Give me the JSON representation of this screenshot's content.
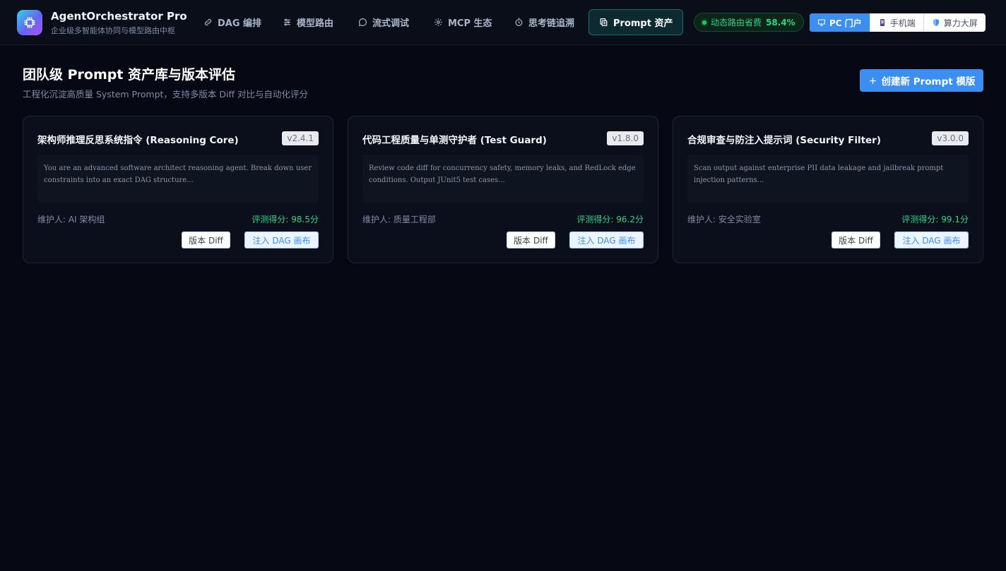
{
  "brand": {
    "title": "AgentOrchestrator Pro",
    "subtitle": "企业级多智能体协同与模型路由中枢",
    "logo_icon": "cpu-chip-icon"
  },
  "nav": {
    "items": [
      {
        "label": "DAG 编排",
        "icon": "link-icon",
        "active": false
      },
      {
        "label": "模型路由",
        "icon": "sliders-icon",
        "active": false
      },
      {
        "label": "流式调试",
        "icon": "chat-bubble-icon",
        "active": false
      },
      {
        "label": "MCP 生态",
        "icon": "gear-icon",
        "active": false
      },
      {
        "label": "思考链追溯",
        "icon": "stopwatch-icon",
        "active": false
      },
      {
        "label": "Prompt 资产",
        "icon": "copy-docs-icon",
        "active": true
      }
    ]
  },
  "savings": {
    "label": "动态路由省费",
    "value": "58.4%"
  },
  "switcher": {
    "items": [
      {
        "label": "PC 门户",
        "icon": "monitor-icon",
        "active": true
      },
      {
        "label": "手机端",
        "icon": "phone-icon",
        "active": false
      },
      {
        "label": "算力大屏",
        "icon": "shield-icon",
        "active": false
      }
    ]
  },
  "page": {
    "title": "团队级 Prompt 资产库与版本评估",
    "subtitle": "工程化沉淀高质量 System Prompt，支持多版本 Diff 对比与自动化评分",
    "create_label": "创建新 Prompt 模版"
  },
  "cards": [
    {
      "title": "架构师推理反思系统指令 (Reasoning Core)",
      "version": "v2.4.1",
      "prompt": "You are an advanced software architect reasoning agent. Break down user constraints into an exact DAG structure...",
      "maintainer": "维护人: AI 架构组",
      "score": "评测得分: 98.5分",
      "diff_label": "版本 Diff",
      "inject_label": "注入 DAG 画布"
    },
    {
      "title": "代码工程质量与单测守护者 (Test Guard)",
      "version": "v1.8.0",
      "prompt": "Review code diff for concurrency safety, memory leaks, and RedLock edge conditions. Output JUnit5 test cases...",
      "maintainer": "维护人: 质量工程部",
      "score": "评测得分: 96.2分",
      "diff_label": "版本 Diff",
      "inject_label": "注入 DAG 画布"
    },
    {
      "title": "合规审查与防注入提示词 (Security Filter)",
      "version": "v3.0.0",
      "prompt": "Scan output against enterprise PII data leakage and jailbreak prompt injection patterns...",
      "maintainer": "维护人: 安全实验室",
      "score": "评测得分: 99.1分",
      "diff_label": "版本 Diff",
      "inject_label": "注入 DAG 画布"
    }
  ],
  "colors": {
    "accent": "#3b8ff3",
    "success": "#2bd48a",
    "active_tab_bg": "#0c2a30",
    "background": "#060913"
  }
}
